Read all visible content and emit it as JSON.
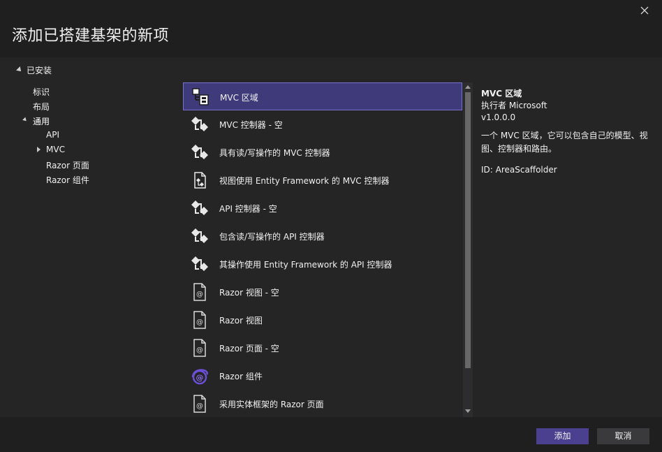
{
  "dialog": {
    "title": "添加已搭建基架的新项"
  },
  "tree": {
    "root_label": "已安装",
    "items": [
      {
        "label": "标识"
      },
      {
        "label": "布局"
      },
      {
        "label": "通用"
      },
      {
        "label": "API"
      },
      {
        "label": "MVC"
      },
      {
        "label": "Razor 页面"
      },
      {
        "label": "Razor 组件"
      }
    ]
  },
  "templates": [
    {
      "label": "MVC 区域",
      "icon": "area-icon"
    },
    {
      "label": "MVC 控制器 - 空",
      "icon": "controller-icon"
    },
    {
      "label": "具有读/写操作的 MVC 控制器",
      "icon": "controller-icon"
    },
    {
      "label": "视图使用 Entity Framework 的 MVC 控制器",
      "icon": "ef-controller-icon"
    },
    {
      "label": "API 控制器 - 空",
      "icon": "controller-icon"
    },
    {
      "label": "包含读/写操作的 API 控制器",
      "icon": "controller-icon"
    },
    {
      "label": "其操作使用 Entity Framework 的 API 控制器",
      "icon": "controller-icon"
    },
    {
      "label": "Razor 视图 - 空",
      "icon": "razor-file-icon"
    },
    {
      "label": "Razor 视图",
      "icon": "razor-file-icon"
    },
    {
      "label": "Razor 页面 - 空",
      "icon": "razor-file-icon"
    },
    {
      "label": "Razor 组件",
      "icon": "blazor-icon"
    },
    {
      "label": "采用实体框架的 Razor 页面",
      "icon": "razor-file-icon"
    }
  ],
  "details": {
    "name": "MVC 区域",
    "author": "执行者 Microsoft",
    "version": "v1.0.0.0",
    "description": "一个 MVC 区域，它可以包含自己的模型、视图、控制器和路由。",
    "id": "ID: AreaScaffolder"
  },
  "buttons": {
    "add": "添加",
    "cancel": "取消"
  },
  "colors": {
    "accent": "#4b3f8f",
    "selection": "#3f3a7a",
    "selection_border": "#7a72d0"
  }
}
